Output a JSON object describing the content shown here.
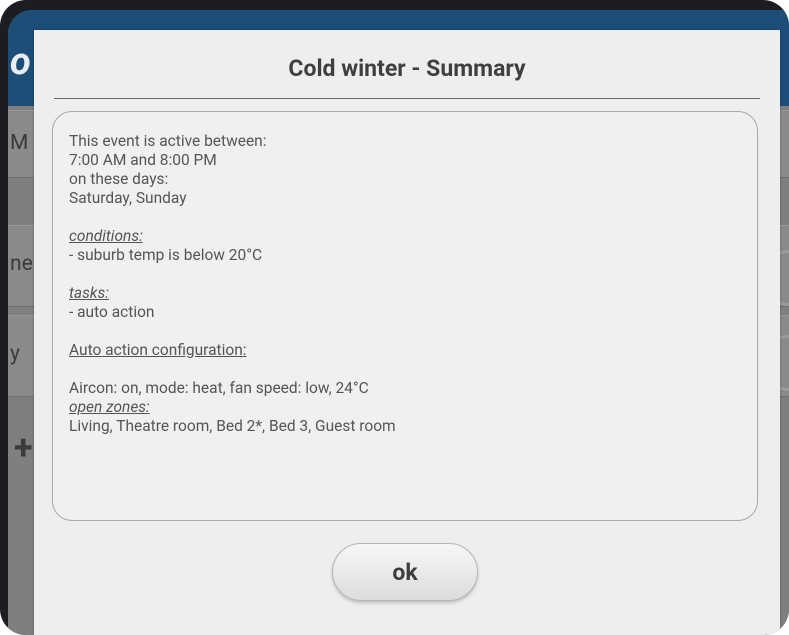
{
  "background": {
    "header_text": "o",
    "row1_text": "M",
    "row2_text": "ne",
    "row3_text": "y",
    "plus_symbol": "+"
  },
  "dialog": {
    "title": "Cold winter - Summary",
    "summary": {
      "line1": "This event is active between:",
      "line2": "7:00 AM and 8:00 PM",
      "line3": "on these days:",
      "line4": "Saturday, Sunday",
      "conditions_label": "conditions:",
      "conditions_item": "- suburb temp is below 20°C",
      "tasks_label": "tasks:",
      "tasks_item": "- auto action",
      "auto_action_label": "Auto action configuration:",
      "aircon_line": "Aircon: on, mode: heat, fan speed: low, 24°C",
      "open_zones_label": "open zones:",
      "open_zones_value": "Living, Theatre room, Bed 2*, Bed 3, Guest room"
    },
    "ok_label": "ok"
  },
  "colors": {
    "header_blue": "#1d4e78",
    "dialog_bg": "#eeeeee",
    "dim_overlay": "#7f7f7f"
  }
}
